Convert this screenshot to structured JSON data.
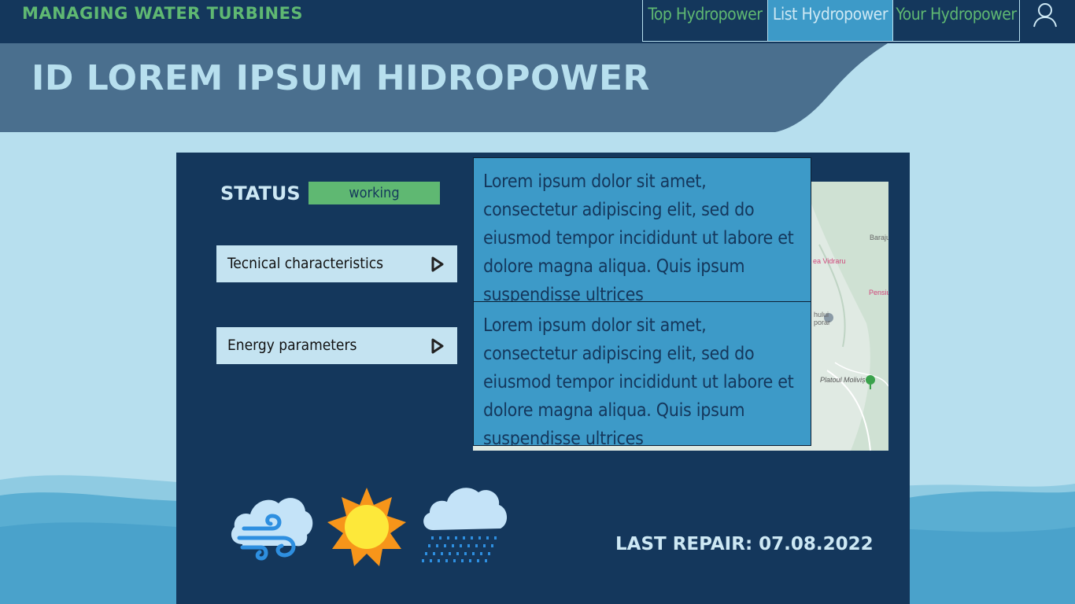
{
  "app": {
    "title": "MANAGING WATER TURBINES"
  },
  "nav": {
    "tabs": [
      {
        "label": "Top Hydropower",
        "active": false
      },
      {
        "label": "List Hydropower",
        "active": true
      },
      {
        "label": "Your Hydropower",
        "active": false
      }
    ],
    "user_icon": "user-icon"
  },
  "header": {
    "title": "ID LOREM IPSUM HIDROPOWER"
  },
  "status": {
    "label": "STATUS",
    "value": "working",
    "color": "#5fb872"
  },
  "sections": [
    {
      "label": "Tecnical characteristics",
      "icon": "play-icon"
    },
    {
      "label": "Energy parameters",
      "icon": "play-icon"
    }
  ],
  "info_boxes": [
    {
      "text": "Lorem ipsum dolor sit amet, consectetur adipiscing elit, sed do eiusmod tempor incididunt ut labore et dolore magna aliqua. Quis ipsum suspendisse ultrices"
    },
    {
      "text": "Lorem ipsum dolor sit amet, consectetur adipiscing elit, sed do eiusmod tempor incididunt ut labore et dolore magna aliqua. Quis ipsum suspendisse ultrices"
    }
  ],
  "map": {
    "labels": {
      "baraj": "Baraju",
      "vidraru": "ea Vidraru",
      "pensiu": "Pensiu",
      "hulu": "hului",
      "porar": "porar",
      "platou": "Platoul Moliviș"
    }
  },
  "weather": {
    "icons": [
      "wind-cloud-icon",
      "sun-icon",
      "rain-cloud-icon"
    ]
  },
  "repair": {
    "text": "LAST REPAIR: 07.08.2022"
  },
  "colors": {
    "navy": "#14375c",
    "accent_green": "#5fb872",
    "light_blue": "#b7dfee",
    "tab_active": "#3d9ac8"
  }
}
